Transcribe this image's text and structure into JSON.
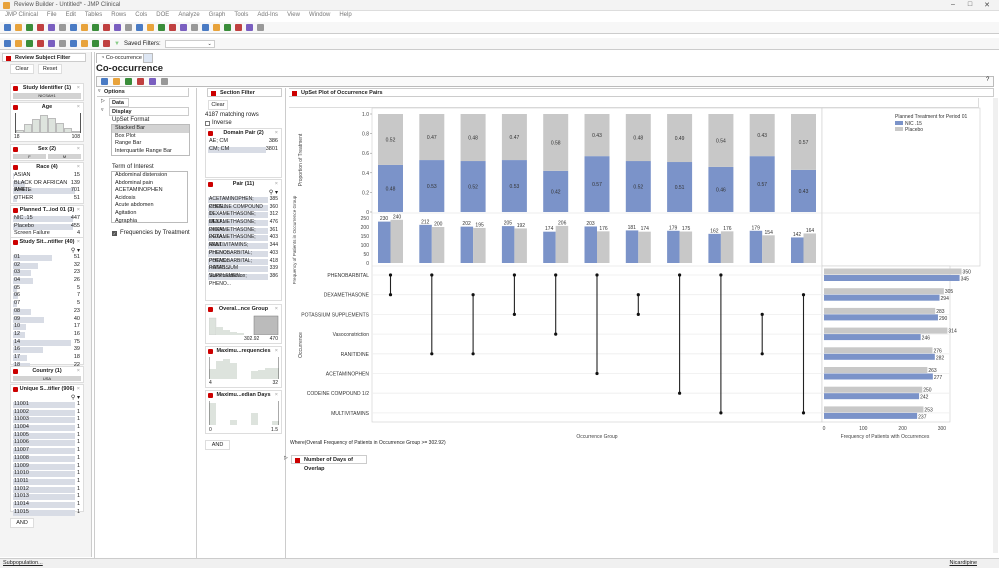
{
  "window": {
    "title": "Review Builder - Untitled* - JMP Clinical",
    "min": "–",
    "max": "□",
    "close": "✕"
  },
  "menu": [
    "JMP Clinical",
    "File",
    "Edit",
    "Tables",
    "Rows",
    "Cols",
    "DOE",
    "Analyze",
    "Graph",
    "Tools",
    "Add-Ins",
    "View",
    "Window",
    "Help"
  ],
  "toolbar2": {
    "saved_filters_label": "Saved Filters:"
  },
  "left": {
    "title": "Review Subject Filter",
    "clear": "Clear",
    "reset": "Reset",
    "study_id": {
      "title": "Study Identifier (1)",
      "value": "NICSAH1"
    },
    "age": {
      "title": "Age",
      "min": "18",
      "max": "108",
      "hist": [
        0.15,
        0.45,
        0.7,
        0.9,
        0.75,
        0.5,
        0.25,
        0.1
      ]
    },
    "sex": {
      "title": "Sex (2)",
      "values": [
        "F",
        "M"
      ]
    },
    "race": {
      "title": "Race (4)",
      "items": [
        {
          "label": "ASIAN",
          "count": "15",
          "frac": 0.02
        },
        {
          "label": "BLACK OR AFRICAN AME...",
          "count": "139",
          "frac": 0.2
        },
        {
          "label": "WHITE",
          "count": "701",
          "frac": 1
        },
        {
          "label": "OTHER",
          "count": "51",
          "frac": 0.07
        }
      ]
    },
    "planned": {
      "title": "Planned T...iod 01 (3)",
      "items": [
        {
          "label": "NIC .15",
          "count": "447",
          "frac": 1
        },
        {
          "label": "Placebo",
          "count": "455",
          "frac": 1
        },
        {
          "label": "Screen Failure",
          "count": "4",
          "frac": 0
        }
      ]
    },
    "site": {
      "title": "Study Sit...ntifier (40)",
      "items": [
        {
          "label": "01",
          "count": "51",
          "frac": 0.68
        },
        {
          "label": "02",
          "count": "32",
          "frac": 0.43
        },
        {
          "label": "03",
          "count": "23",
          "frac": 0.31
        },
        {
          "label": "04",
          "count": "26",
          "frac": 0.35
        },
        {
          "label": "05",
          "count": "5",
          "frac": 0.07
        },
        {
          "label": "06",
          "count": "7",
          "frac": 0.09
        },
        {
          "label": "07",
          "count": "5",
          "frac": 0.07
        },
        {
          "label": "08",
          "count": "23",
          "frac": 0.31
        },
        {
          "label": "09",
          "count": "40",
          "frac": 0.53
        },
        {
          "label": "10",
          "count": "17",
          "frac": 0.23
        },
        {
          "label": "12",
          "count": "16",
          "frac": 0.21
        },
        {
          "label": "14",
          "count": "75",
          "frac": 1
        },
        {
          "label": "16",
          "count": "39",
          "frac": 0.52
        },
        {
          "label": "17",
          "count": "18",
          "frac": 0.24
        },
        {
          "label": "18",
          "count": "22",
          "frac": 0.29
        }
      ]
    },
    "country": {
      "title": "Country (1)",
      "value": "USA"
    },
    "usubjid": {
      "title": "Unique S...tifier (906)",
      "items": [
        {
          "label": "11001",
          "count": "1"
        },
        {
          "label": "11002",
          "count": "1"
        },
        {
          "label": "11003",
          "count": "1"
        },
        {
          "label": "11004",
          "count": "1"
        },
        {
          "label": "11005",
          "count": "1"
        },
        {
          "label": "11006",
          "count": "1"
        },
        {
          "label": "11007",
          "count": "1"
        },
        {
          "label": "11008",
          "count": "1"
        },
        {
          "label": "11009",
          "count": "1"
        },
        {
          "label": "11010",
          "count": "1"
        },
        {
          "label": "11011",
          "count": "1"
        },
        {
          "label": "11012",
          "count": "1"
        },
        {
          "label": "11013",
          "count": "1"
        },
        {
          "label": "11014",
          "count": "1"
        },
        {
          "label": "11015",
          "count": "1"
        }
      ]
    },
    "and": "AND",
    "subpop": "Subpopulation..."
  },
  "tab": {
    "label": "Co-occurrence"
  },
  "page_title": "Co-occurrence",
  "options": {
    "title": "Options",
    "data": "Data",
    "display": "Display",
    "upset_label": "UpSet Format",
    "upset_options": [
      "Stacked Bar",
      "Box Plot",
      "Range Bar",
      "Interquartile Range Bar"
    ],
    "upset_selected": 0,
    "term_label": "Term of Interest",
    "terms": [
      "Abdominal distension",
      "Abdominal pain",
      "ACETAMINOPHEN",
      "Acidosis",
      "Acute abdomen",
      "Agitation",
      "Agraphia"
    ],
    "freq_by_trt": "Frequencies by Treatment",
    "freq_by_trt_checked": true
  },
  "section_filter": {
    "title": "Section Filter",
    "clear": "Clear",
    "matching": "4187 matching rows",
    "inverse": "Inverse",
    "domain_pair": {
      "title": "Domain Pair (2)",
      "items": [
        {
          "label": "AE; CM",
          "count": "386"
        },
        {
          "label": "CM; CM",
          "count": "3801"
        }
      ]
    },
    "pair": {
      "title": "Pair (11)",
      "items": [
        {
          "label": "ACETAMINOPHEN; PHEN...",
          "count": "385"
        },
        {
          "label": "CODEINE COMPOUND 1/...",
          "count": "360"
        },
        {
          "label": "DEXAMETHASONE; MULT...",
          "count": "312"
        },
        {
          "label": "DEXAMETHASONE; PHEN...",
          "count": "476"
        },
        {
          "label": "DEXAMETHASONE; POTA...",
          "count": "361"
        },
        {
          "label": "DEXAMETHASONE; RANI...",
          "count": "403"
        },
        {
          "label": "MULTIVITAMINS; PHENO...",
          "count": "344"
        },
        {
          "label": "PHENOBARBITAL; POTAS...",
          "count": "403"
        },
        {
          "label": "PHENOBARBITAL; RANITI...",
          "count": "418"
        },
        {
          "label": "POTASSIUM SUPPLEMEN...",
          "count": "339"
        },
        {
          "label": "Vasoconstriction; PHENO...",
          "count": "386"
        }
      ]
    },
    "overall": {
      "title": "Overal...nce Group",
      "min": "302.92",
      "max": "470"
    },
    "maxfreq": {
      "title": "Maximu...requencies",
      "min": "4",
      "max": "32"
    },
    "maxdays": {
      "title": "Maximu...edian Days",
      "min": "0",
      "max": "1.5"
    },
    "and": "AND"
  },
  "plot": {
    "title": "UpSet Plot of Occurrence Pairs",
    "where": "Where(Overall Frequency of Patients in Occurrence Group >= 302.92)",
    "overlap_title": "Number of Days of Overlap"
  },
  "chart_data": {
    "type": "upset",
    "legend": {
      "title": "Planned Treatment for Period 01",
      "position": "top-right"
    },
    "series_names": [
      "NIC .15",
      "Placebo"
    ],
    "colors": {
      "NIC .15": "#7b93c9",
      "Placebo": "#c8c8c8"
    },
    "proportion": {
      "ylabel": "Proportion of Treatment",
      "ylim": [
        0,
        1
      ],
      "ticks": [
        "0",
        "0.2",
        "0.4",
        "0.6",
        "0.8",
        "1.0"
      ],
      "NIC": [
        0.48,
        0.53,
        0.52,
        0.53,
        0.42,
        0.57,
        0.52,
        0.51,
        0.46,
        0.57,
        0.43
      ],
      "Placebo": [
        0.52,
        0.47,
        0.48,
        0.47,
        0.58,
        0.43,
        0.48,
        0.49,
        0.54,
        0.43,
        0.57
      ]
    },
    "frequency": {
      "ylabel": "Frequency of Patients in Occurrence Group",
      "ylim": [
        0,
        250
      ],
      "ticks": [
        "0",
        "50",
        "100",
        "150",
        "200",
        "250"
      ],
      "NIC": [
        230,
        212,
        202,
        205,
        174,
        203,
        181,
        179,
        162,
        179,
        142
      ],
      "Placebo": [
        240,
        200,
        195,
        192,
        206,
        176,
        174,
        175,
        176,
        154,
        164
      ]
    },
    "matrix": {
      "ylabel": "Occurrence",
      "xlabel": "Occurrence Group",
      "rows": [
        "PHENOBARBITAL",
        "DEXAMETHASONE",
        "POTASSIUM SUPPLEMENTS",
        "Vasoconstriction",
        "RANITIDINE",
        "ACETAMINOPHEN",
        "CODEINE COMPOUND 1/2",
        "MULTIVITAMINS"
      ],
      "groups": [
        [
          0,
          1
        ],
        [
          0,
          4
        ],
        [
          1,
          4
        ],
        [
          0,
          2
        ],
        [
          0,
          3
        ],
        [
          0,
          5
        ],
        [
          1,
          2
        ],
        [
          0,
          6
        ],
        [
          0,
          7
        ],
        [
          2,
          4
        ],
        [
          1,
          7
        ]
      ]
    },
    "row_totals": {
      "xlabel": "Frequency of Patients with Occurrences",
      "xlim": [
        0,
        350
      ],
      "ticks": [
        "0",
        "100",
        "200",
        "300"
      ],
      "Placebo": [
        350,
        305,
        283,
        314,
        276,
        263,
        250,
        253
      ],
      "NIC": [
        345,
        294,
        290,
        246,
        282,
        277,
        242,
        237
      ]
    }
  },
  "status": {
    "right": "Nicardipine"
  }
}
